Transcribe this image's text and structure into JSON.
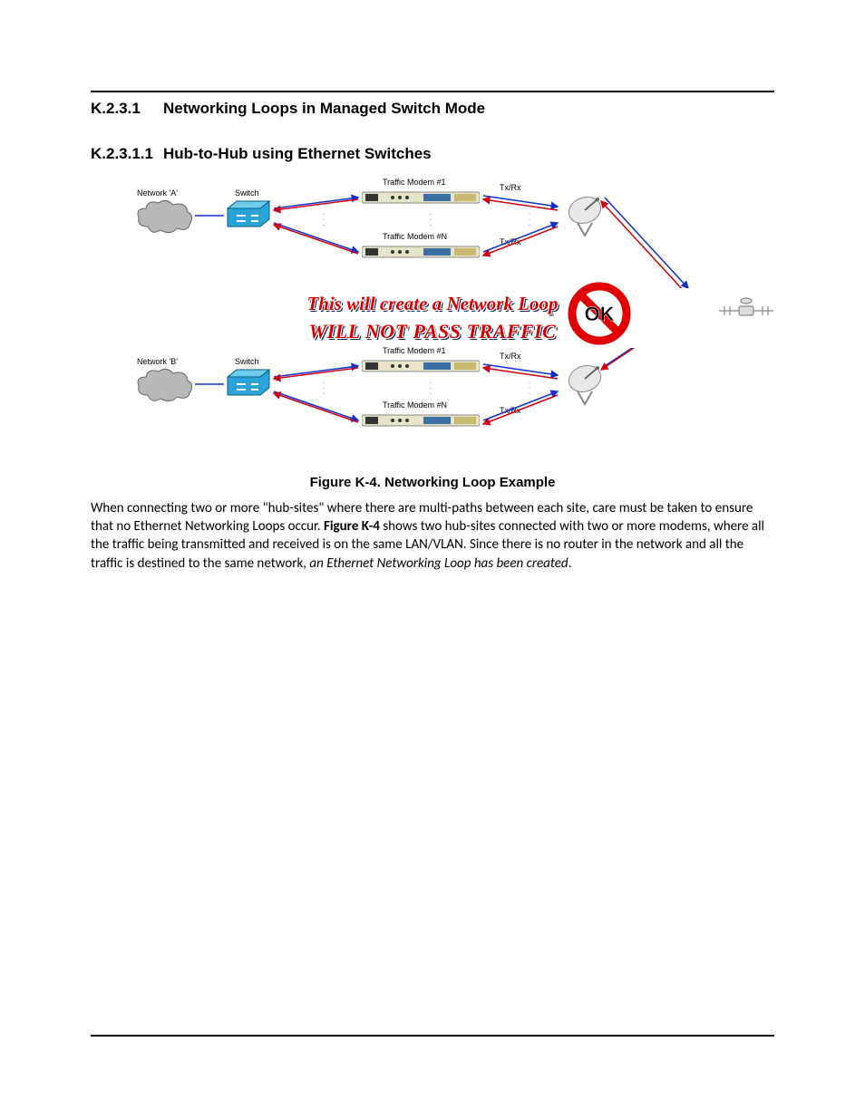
{
  "headings": {
    "h1_num": "K.2.3.1",
    "h1_text": "Networking Loops in Managed Switch Mode",
    "h2_num": "K.2.3.1.1",
    "h2_text": "Hub-to-Hub using Ethernet Switches"
  },
  "diagram": {
    "topA": {
      "network_label": "Network 'A'",
      "switch_label": "Switch",
      "modem1_label": "Traffic Modem #1",
      "modemN_label": "Traffic Modem #N",
      "txrx": "Tx/Rx"
    },
    "loop_line1": "This will create a Network Loop",
    "loop_line2": "WILL NOT PASS TRAFFIC",
    "no_ok_label": "OK",
    "topB": {
      "network_label": "Network 'B'",
      "switch_label": "Switch",
      "modem1_label": "Traffic Modem #1",
      "modemN_label": "Traffic Modem #N",
      "txrx": "Tx/Rx"
    }
  },
  "caption": "Figure K-4. Networking Loop Example",
  "paragraph": {
    "pre": "When connecting two or more \"hub-sites\" where there are multi-paths between each site, care must be taken to ensure that no Ethernet Networking Loops occur. ",
    "bold": "Figure K-4",
    "mid": " shows two hub-sites connected with two or more modems, where all the traffic being transmitted and received is on the same LAN/VLAN. Since there is no router in the network and all the traffic is destined to the same network, ",
    "italic": "an Ethernet Networking Loop has been created",
    "post": "."
  }
}
